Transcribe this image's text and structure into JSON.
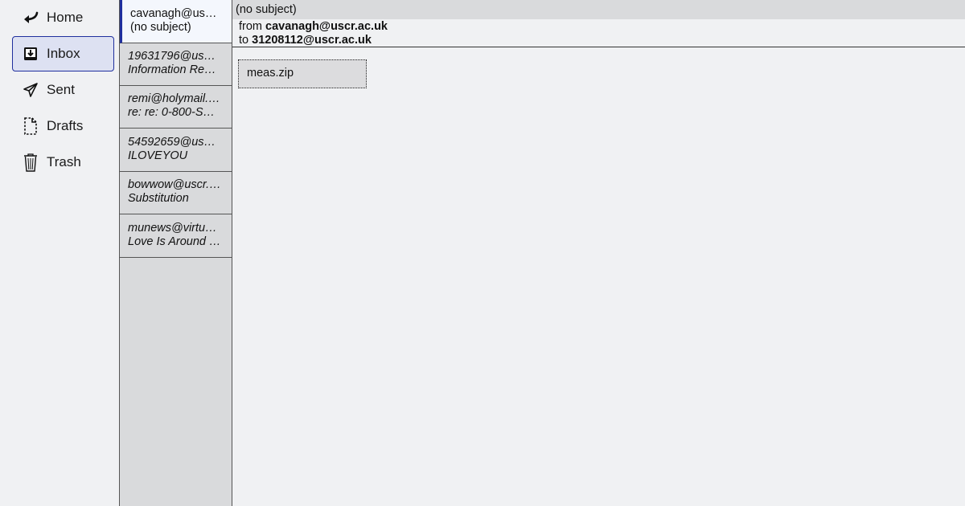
{
  "nav": {
    "items": [
      {
        "label": "Home",
        "icon": "home-arrow-icon"
      },
      {
        "label": "Inbox",
        "icon": "inbox-icon",
        "active": true
      },
      {
        "label": "Sent",
        "icon": "send-icon"
      },
      {
        "label": "Drafts",
        "icon": "draft-icon"
      },
      {
        "label": "Trash",
        "icon": "trash-icon"
      }
    ]
  },
  "messages": [
    {
      "from": "cavanagh@us…",
      "subject": "(no subject)",
      "selected": true
    },
    {
      "from": "19631796@us…",
      "subject": "Information Re…"
    },
    {
      "from": "remi@holymail.…",
      "subject": "re: re: 0-800-S…"
    },
    {
      "from": "54592659@us…",
      "subject": "ILOVEYOU"
    },
    {
      "from": "bowwow@uscr.…",
      "subject": "Substitution"
    },
    {
      "from": "munews@virtu…",
      "subject": "Love Is Around …"
    }
  ],
  "reader": {
    "subject": "(no subject)",
    "from_label": "from",
    "from": "cavanagh@uscr.ac.uk",
    "to_label": "to",
    "to": "31208112@uscr.ac.uk",
    "attachment": "meas.zip"
  },
  "colors": {
    "accent": "#1f2f9e",
    "active_bg": "#dde1f2",
    "panel": "#d9dadc",
    "background": "#f0f1f3"
  }
}
